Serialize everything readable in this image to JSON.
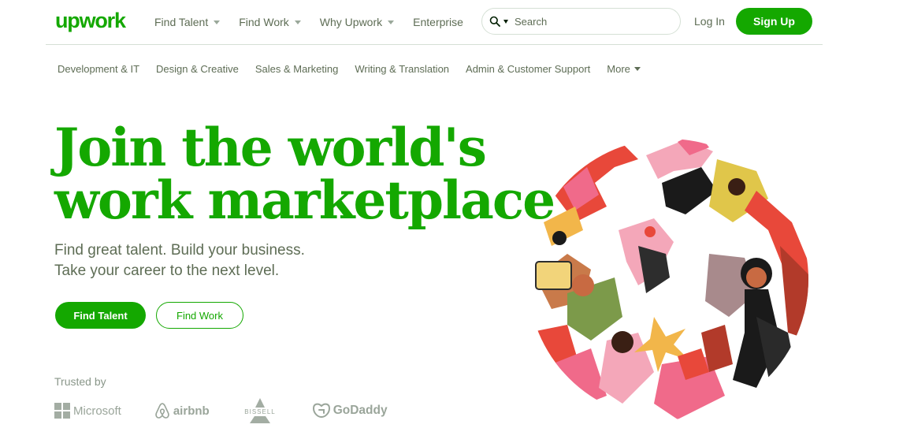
{
  "brand": {
    "logo_text": "upwork"
  },
  "colors": {
    "accent": "#14a800",
    "text_muted": "#5e6d55",
    "logo_gray": "#9aa59a"
  },
  "nav": {
    "items": [
      {
        "label": "Find Talent",
        "has_dropdown": true
      },
      {
        "label": "Find Work",
        "has_dropdown": true
      },
      {
        "label": "Why Upwork",
        "has_dropdown": true
      },
      {
        "label": "Enterprise",
        "has_dropdown": false
      }
    ],
    "search": {
      "placeholder": "Search",
      "icon": "search-icon"
    },
    "login_label": "Log In",
    "signup_label": "Sign Up"
  },
  "categories": {
    "items": [
      "Development & IT",
      "Design & Creative",
      "Sales & Marketing",
      "Writing & Translation",
      "Admin & Customer Support"
    ],
    "more_label": "More"
  },
  "hero": {
    "title_line1": "Join the world's",
    "title_line2": "work marketplace",
    "subtitle_line1": "Find great talent. Build your business.",
    "subtitle_line2": "Take your career to the next level.",
    "primary_button": "Find Talent",
    "secondary_button": "Find Work"
  },
  "trusted": {
    "label": "Trusted by",
    "logos": [
      {
        "name": "Microsoft",
        "icon": "windows-logo"
      },
      {
        "name": "airbnb",
        "icon": "airbnb-logo"
      },
      {
        "name": "BISSELL",
        "icon": "bissell-logo"
      },
      {
        "name": "GoDaddy",
        "icon": "godaddy-logo"
      }
    ]
  }
}
